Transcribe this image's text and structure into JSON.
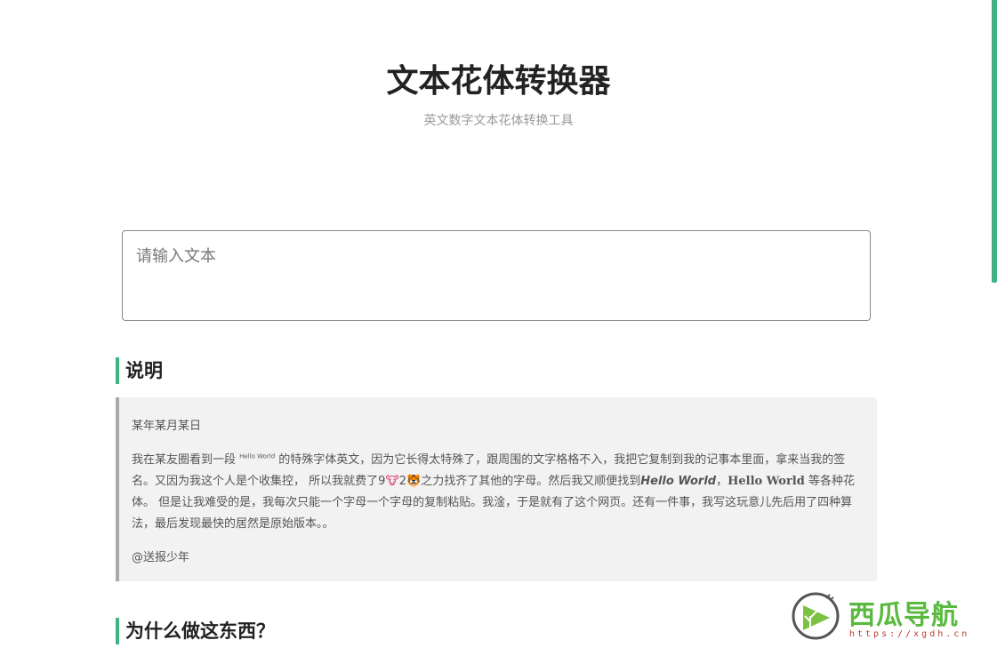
{
  "header": {
    "title": "文本花体转换器",
    "subtitle": "英文数字文本花体转换工具"
  },
  "input": {
    "placeholder": "请输入文本",
    "value": ""
  },
  "sections": {
    "explain": {
      "heading": "说明",
      "date": "某年某月某日",
      "p1_a": "我在某友圈看到一段 ",
      "p1_tiny": "Hello World",
      "p1_b": " 的特殊字体英文，因为它长得太特殊了，跟周围的文字格格不入，我把它复制到我的记事本里面，拿来当我的签名。又因为我这个人是个收集控， 所以我就费了9",
      "p1_emoji1": "🐮",
      "p1_c": "2",
      "p1_emoji2": "🐯",
      "p1_d": "之力找齐了其他的字母。然后我又顺便找到",
      "p1_bolditalic": "Hello World",
      "p1_e": "，",
      "p1_serifbold": "Hello World",
      "p1_f": " 等各种花体。 但是让我难受的是，我每次只能一个字母一个字母的复制粘贴。我淦，于是就有了这个网页。还有一件事，我写这玩意儿先后用了四种算法，最后发现最快的居然是原始版本。。",
      "signature": "@送报少年"
    },
    "why": {
      "heading": "为什么做这东西？"
    }
  },
  "watermark": {
    "name": "西瓜导航",
    "url": "https://xgdh.cn"
  },
  "colors": {
    "accent": "#3fb27f",
    "quote_bg": "#f2f2f2",
    "watermark_green": "#5ab93f"
  }
}
